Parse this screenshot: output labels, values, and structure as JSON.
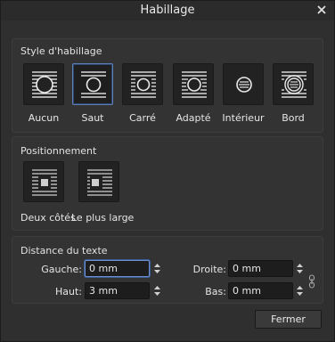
{
  "window": {
    "title": "Habillage"
  },
  "style_section": {
    "title": "Style d'habillage",
    "options": [
      {
        "label": "Aucun",
        "icon": "wrap-none-icon"
      },
      {
        "label": "Saut",
        "icon": "wrap-jump-icon",
        "selected": true
      },
      {
        "label": "Carré",
        "icon": "wrap-square-icon"
      },
      {
        "label": "Adapté",
        "icon": "wrap-tight-icon"
      },
      {
        "label": "Intérieur",
        "icon": "wrap-inside-icon"
      },
      {
        "label": "Bord",
        "icon": "wrap-border-icon"
      }
    ]
  },
  "position_section": {
    "title": "Positionnement",
    "options": [
      {
        "label": "Deux côtés",
        "icon": "both-sides-icon"
      },
      {
        "label": "Le plus large",
        "icon": "largest-side-icon"
      }
    ]
  },
  "distance_section": {
    "title": "Distance du texte",
    "left": {
      "label": "Gauche:",
      "value": "0 mm"
    },
    "right": {
      "label": "Droite:",
      "value": "0 mm"
    },
    "top": {
      "label": "Haut:",
      "value": "3 mm"
    },
    "bottom": {
      "label": "Bas:",
      "value": "0 mm"
    }
  },
  "buttons": {
    "close": "Fermer"
  },
  "colors": {
    "accent": "#6b8fcf",
    "panel": "#333333",
    "tile": "#222222"
  }
}
